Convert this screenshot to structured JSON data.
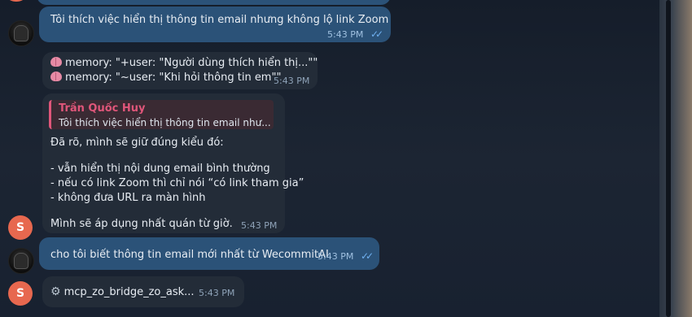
{
  "messages": {
    "m1": {
      "text": "Tôi thích việc hiển thị thông tin email nhưng không lộ link Zoom",
      "time": "5:43 PM",
      "status": "read"
    },
    "m2": {
      "line1": "memory: \"+user: \"Người dùng thích hiển thị...\"\"",
      "line2": "memory: \"~user: \"Khi hỏi thông tin em\"\"",
      "time": "5:43 PM",
      "icon": "brain-icon"
    },
    "m3": {
      "reply_name": "Trần Quốc Huy",
      "reply_text": "Tôi thích việc hiển thị thông tin email như...",
      "lines": [
        "Đã rõ, mình sẽ giữ đúng kiểu đó:",
        "",
        "- vẫn hiển thị nội dung email bình thường",
        "- nếu có link Zoom thì chỉ nói “có link tham gia”",
        "- không đưa URL ra màn hình",
        "",
        "Mình sẽ áp dụng nhất quán từ giờ."
      ],
      "time": "5:43 PM",
      "avatar_letter": "S"
    },
    "m4": {
      "text": "cho tôi biết thông tin email mới nhất từ WecommitAI",
      "time": "5:43 PM",
      "status": "read"
    },
    "m5": {
      "text": "mcp_zo_bridge_zo_ask...",
      "time": "5:43 PM",
      "avatar_letter": "S",
      "icon": "gear-icon"
    }
  },
  "colors": {
    "outgoing_bubble": "#2b5278",
    "incoming_bubble": "#232c38",
    "reply_accent": "#e0567a",
    "bot_avatar": "#e7684f",
    "read_checks": "#6fb0f0"
  }
}
